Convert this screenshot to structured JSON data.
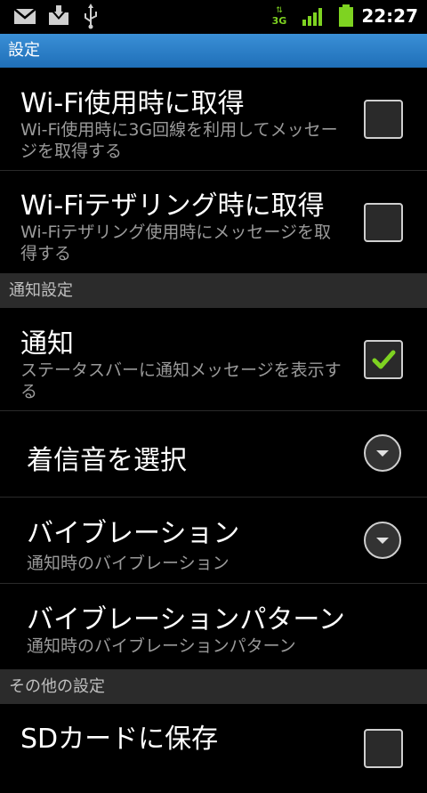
{
  "status_bar": {
    "time": "22:27",
    "icons": [
      "gmail-icon",
      "download-icon",
      "usb-icon",
      "3g-data-icon",
      "signal-icon",
      "battery-icon"
    ],
    "network_label": "3G",
    "accent_color": "#7ed321"
  },
  "header": {
    "title": "設定"
  },
  "items": {
    "wifi_fetch": {
      "title": "Wi-Fi使用時に取得",
      "summary": "Wi-Fi使用時に3G回線を利用してメッセージを取得する",
      "checked": false
    },
    "tethering_fetch": {
      "title": "Wi-Fiテザリング時に取得",
      "summary": "Wi-Fiテザリング使用時にメッセージを取得する",
      "checked": false
    },
    "notify": {
      "title": "通知",
      "summary": "ステータスバーに通知メッセージを表示する",
      "checked": true
    },
    "ringtone": {
      "title": "着信音を選択"
    },
    "vibration": {
      "title": "バイブレーション",
      "summary": "通知時のバイブレーション"
    },
    "vibration_pattern": {
      "title": "バイブレーションパターン",
      "summary": "通知時のバイブレーションパターン"
    },
    "sd_save": {
      "title": "SDカードに保存",
      "checked": false
    }
  },
  "sections": {
    "notification": "通知設定",
    "other": "その他の設定"
  }
}
